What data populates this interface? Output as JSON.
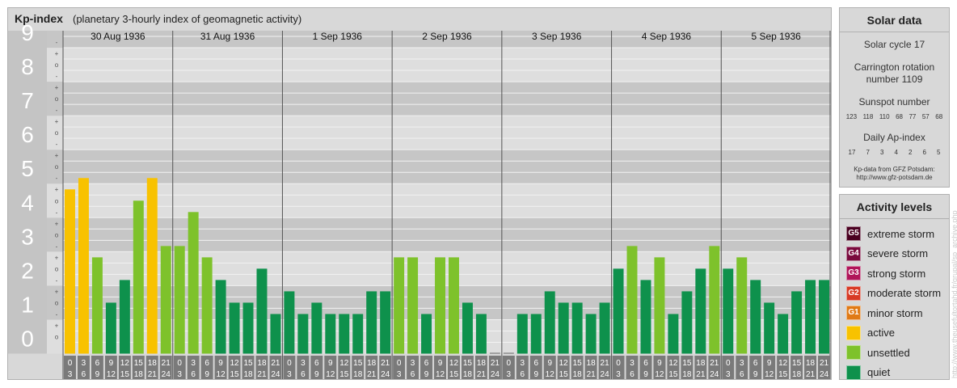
{
  "header": {
    "title": "Kp-index",
    "subtitle": "(planetary 3-hourly index of geomagnetic activity)"
  },
  "colors": {
    "quiet": "#0e914c",
    "unsettled": "#7ec22b",
    "active": "#f8c200",
    "g1": "#e07a16",
    "g2": "#d83a25",
    "g3": "#b01559",
    "g4": "#7a0a3d",
    "g5": "#4a0020"
  },
  "chart_data": {
    "type": "bar",
    "title": "Kp-index",
    "ylabel": "",
    "ylim": [
      0,
      9
    ],
    "y_ticks": [
      "0",
      "1",
      "2",
      "3",
      "4",
      "5",
      "6",
      "7",
      "8",
      "9"
    ],
    "sub_ticks": [
      "+",
      "o",
      "-"
    ],
    "days": [
      "30 Aug 1936",
      "31 Aug 1936",
      "1 Sep 1936",
      "2 Sep 1936",
      "3 Sep 1936",
      "4 Sep 1936",
      "5 Sep 1936"
    ],
    "hour_labels": [
      [
        "0",
        "3"
      ],
      [
        "3",
        "6"
      ],
      [
        "6",
        "9"
      ],
      [
        "9",
        "12"
      ],
      [
        "12",
        "15"
      ],
      [
        "15",
        "18"
      ],
      [
        "18",
        "21"
      ],
      [
        "21",
        "24"
      ]
    ],
    "values": [
      [
        4.0,
        4.333,
        2.0,
        0.667,
        1.333,
        3.667,
        4.333,
        2.333
      ],
      [
        2.333,
        3.333,
        2.0,
        1.333,
        0.667,
        0.667,
        1.667,
        0.333
      ],
      [
        1.0,
        0.333,
        0.667,
        0.333,
        0.333,
        0.333,
        1.0,
        1.0
      ],
      [
        2.0,
        2.0,
        0.333,
        2.0,
        2.0,
        0.667,
        0.333,
        0.0
      ],
      [
        0.0,
        0.333,
        0.333,
        1.0,
        0.667,
        0.667,
        0.333,
        0.667
      ],
      [
        1.667,
        2.333,
        1.333,
        2.0,
        0.333,
        1.0,
        1.667,
        2.333
      ],
      [
        1.667,
        2.0,
        1.333,
        0.667,
        0.333,
        1.0,
        1.333,
        1.333
      ]
    ]
  },
  "solar": {
    "heading": "Solar data",
    "cycle": "Solar cycle 17",
    "carrington_1": "Carrington rotation",
    "carrington_2": "number 1109",
    "sunspot_label": "Sunspot number",
    "sunspots": [
      "123",
      "118",
      "110",
      "68",
      "77",
      "57",
      "68"
    ],
    "ap_label": "Daily Ap-index",
    "ap": [
      "17",
      "7",
      "3",
      "4",
      "2",
      "6",
      "5"
    ],
    "note_1": "Kp-data from GFZ Potsdam:",
    "note_2": "http://www.gfz-potsdam.de"
  },
  "levels": {
    "heading": "Activity levels",
    "items": [
      {
        "code": "G5",
        "label": "extreme storm",
        "color": "#4a0020"
      },
      {
        "code": "G4",
        "label": "severe storm",
        "color": "#7a0a3d"
      },
      {
        "code": "G3",
        "label": "strong storm",
        "color": "#b01559"
      },
      {
        "code": "G2",
        "label": "moderate storm",
        "color": "#d83a25"
      },
      {
        "code": "G1",
        "label": "minor storm",
        "color": "#e07a16"
      },
      {
        "code": "",
        "label": "active",
        "color": "#f8c200"
      },
      {
        "code": "",
        "label": "unsettled",
        "color": "#7ec22b"
      },
      {
        "code": "",
        "label": "quiet",
        "color": "#0e914c"
      }
    ]
  },
  "watermark": "http://www.theusefultortahd.fr/grupal/sp_archive.php"
}
